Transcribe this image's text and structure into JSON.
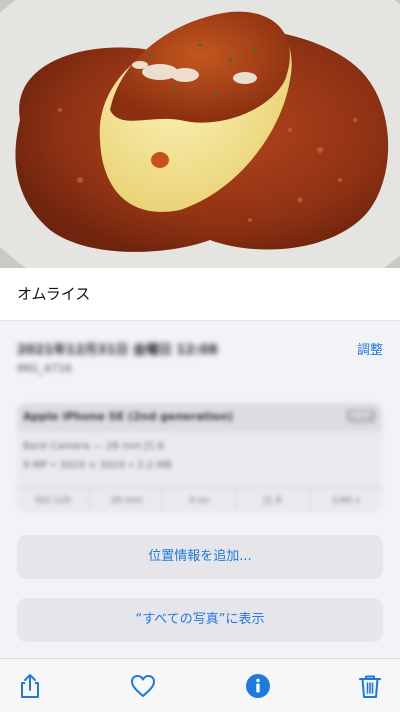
{
  "photo": {
    "alt_subject": "omurice"
  },
  "caption": "オムライス",
  "info": {
    "datetime": "2021年12月31日 金曜日 12:08",
    "filename": "IMG_4716",
    "adjust_label": "調整"
  },
  "camera": {
    "model": "Apple iPhone SE (2nd generation)",
    "format_badge": "HEIF",
    "lens": "Back Camera — 28 mm ƒ1.8",
    "size": "9 MP • 3024 × 3024 • 2.2 MB",
    "specs": [
      "ISO 125",
      "28 mm",
      "0 ev",
      "ƒ1.8",
      "1/40 s"
    ]
  },
  "buttons": {
    "add_location": "位置情報を追加...",
    "show_in_all_photos": "“すべての写真”に表示"
  },
  "toolbar": {
    "accent": "#1f7ae0",
    "icons": [
      "share-icon",
      "heart-icon",
      "info-icon",
      "trash-icon"
    ]
  }
}
